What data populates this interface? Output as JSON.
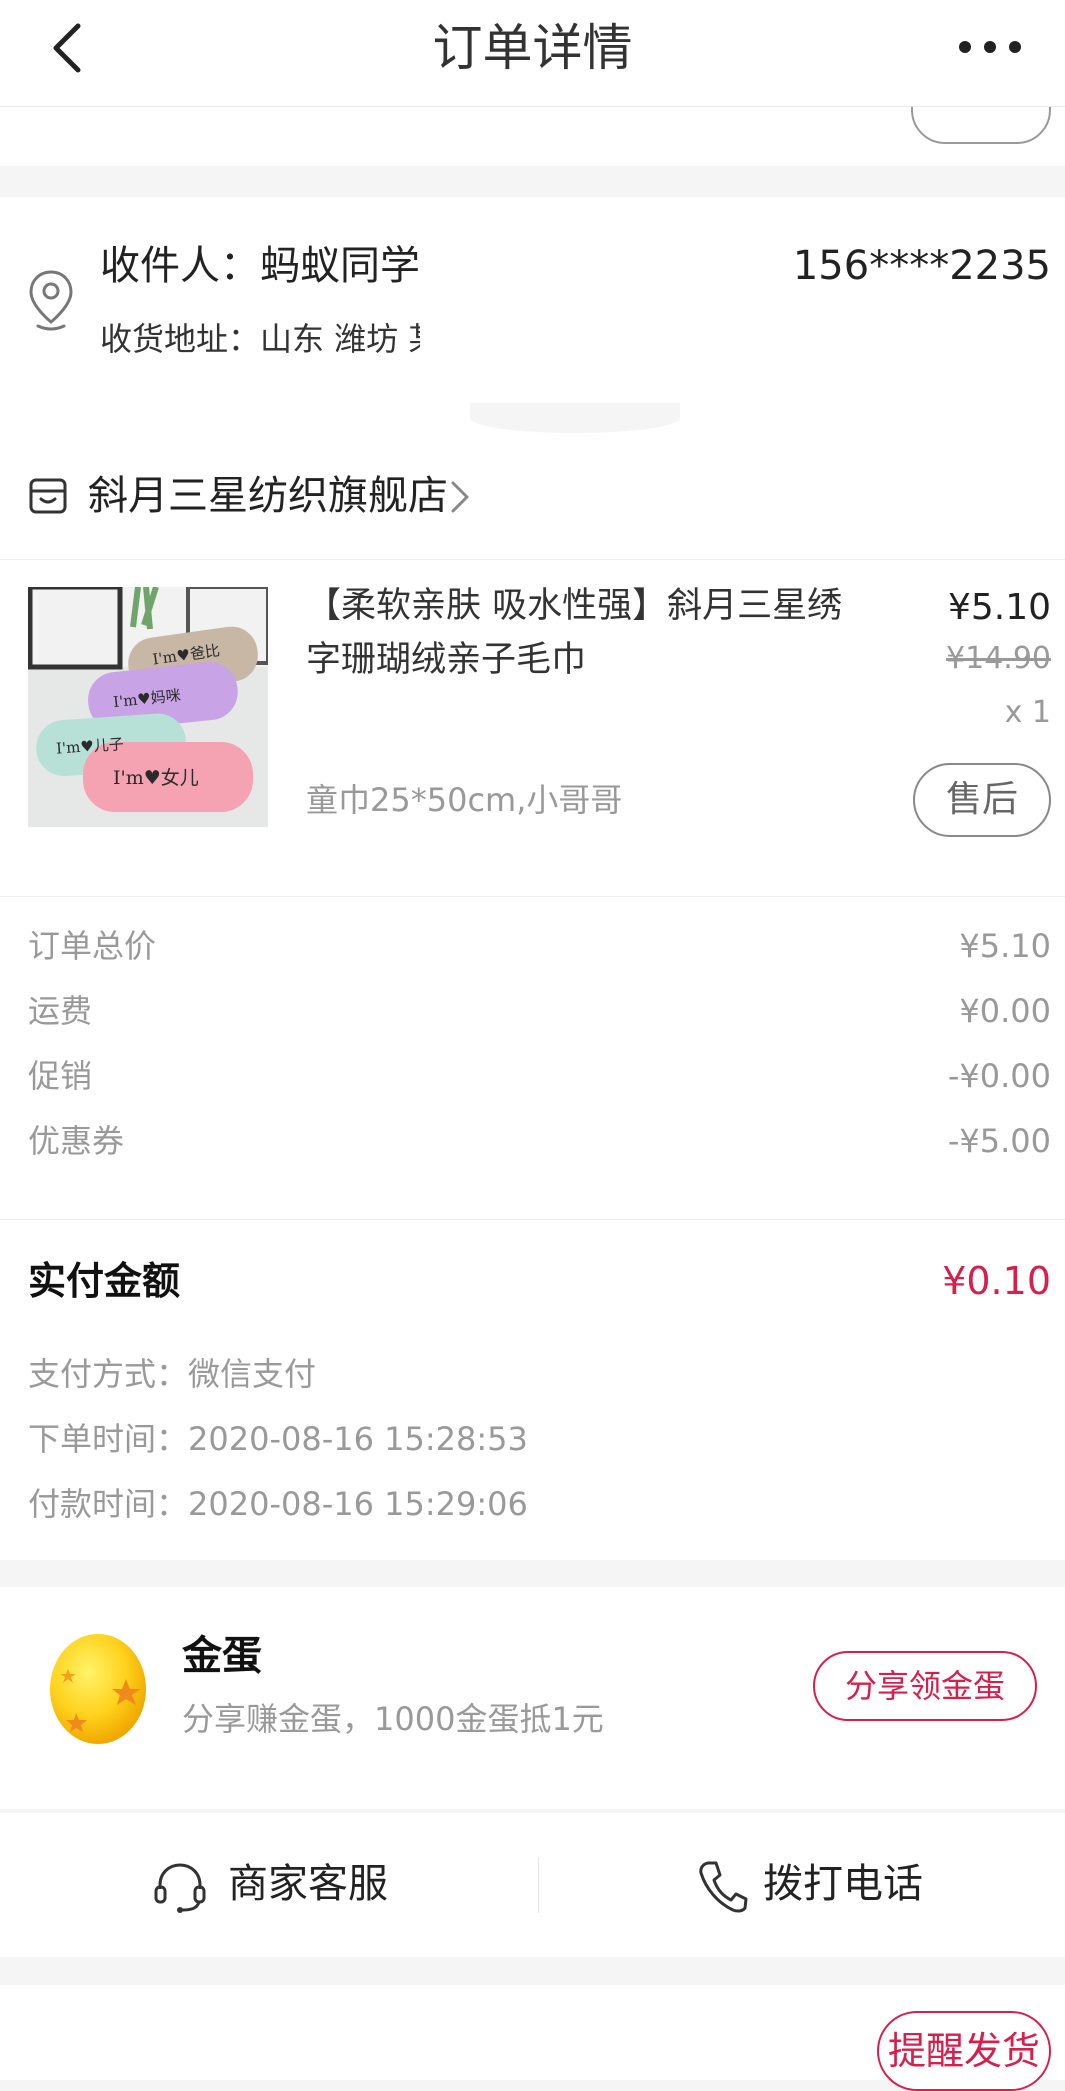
{
  "header": {
    "title": "订单详情"
  },
  "address": {
    "recipient": "收件人：蚂蚁同学",
    "phone": "156****2235",
    "address": "收货地址：山东 潍坊 某"
  },
  "store": {
    "name": "斜月三星纺织旗舰店"
  },
  "product": {
    "title": "【柔软亲肤 吸水性强】斜月三星绣字珊瑚绒亲子毛巾",
    "price": "¥5.10",
    "original_price": "¥14.90",
    "quantity": "x 1",
    "spec": "童巾25*50cm,小哥哥",
    "after_sale_label": "售后",
    "towel_labels": [
      "I'm♥爸比",
      "I'm♥妈咪",
      "I'm♥儿子",
      "I'm♥女儿"
    ]
  },
  "summary": [
    {
      "label": "订单总价",
      "value": "¥5.10"
    },
    {
      "label": "运费",
      "value": "¥0.00"
    },
    {
      "label": "促销",
      "value": "-¥0.00"
    },
    {
      "label": "优惠券",
      "value": "-¥5.00"
    }
  ],
  "payment": {
    "label": "实付金额",
    "amount": "¥0.10",
    "method": "支付方式：微信支付",
    "order_time": "下单时间：2020-08-16 15:28:53",
    "pay_time": "付款时间：2020-08-16 15:29:06"
  },
  "egg": {
    "title": "金蛋",
    "desc": "分享赚金蛋，1000金蛋抵1元",
    "button": "分享领金蛋"
  },
  "service": {
    "merchant": "商家客服",
    "call": "拨打电话"
  },
  "bottom": {
    "remind": "提醒发货"
  },
  "colors": {
    "accent": "#d81e4a",
    "muted": "#999999"
  }
}
